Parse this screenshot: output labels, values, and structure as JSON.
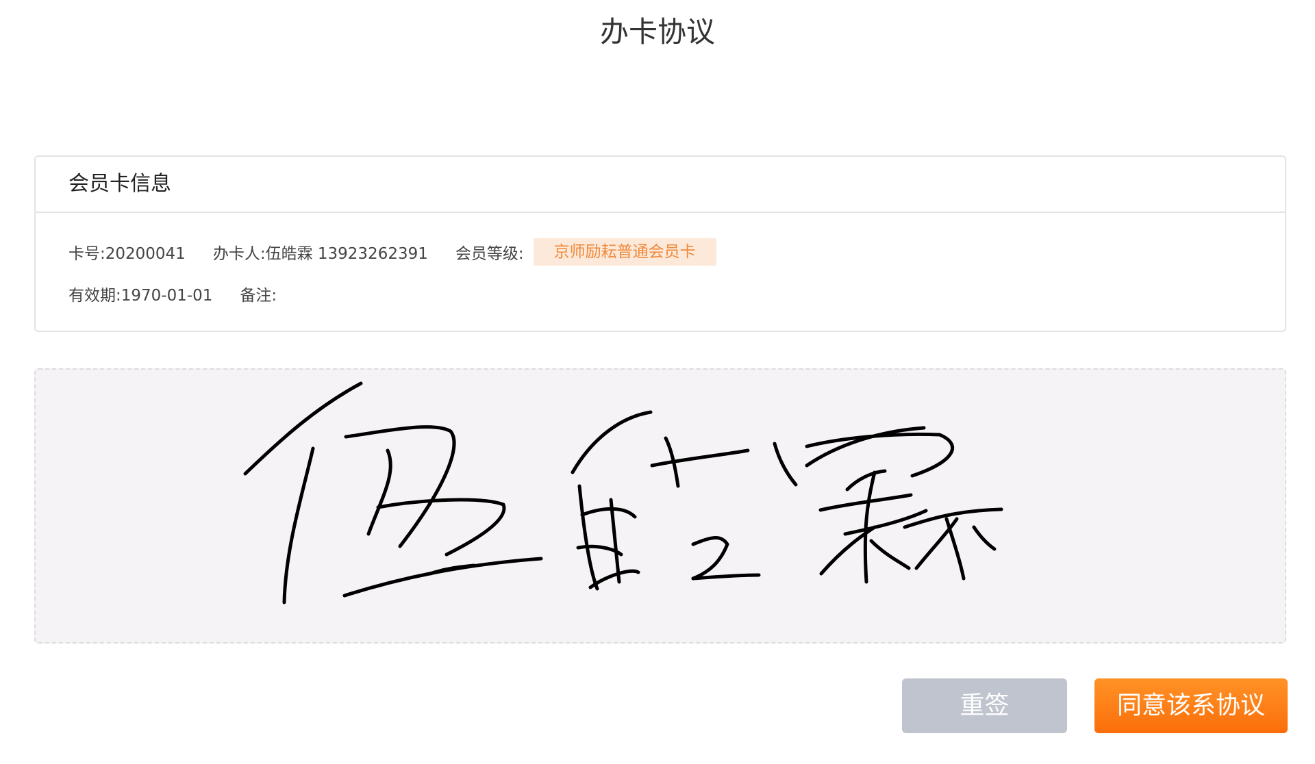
{
  "page": {
    "title": "办卡协议"
  },
  "card_info": {
    "header": "会员卡信息",
    "card_no": "卡号:20200041",
    "applicant": "办卡人:伍皓霖 13923262391",
    "level_label": "会员等级:",
    "level_value": "京师励耘普通会员卡",
    "validity": "有效期:1970-01-01",
    "remark": "备注:"
  },
  "signature": {
    "handwritten_text": "伍皓霖",
    "ink_color": "#000000",
    "pad_background": "#f6f3f6"
  },
  "actions": {
    "reset_label": "重签",
    "agree_label": "同意该系协议"
  },
  "colors": {
    "accent": "#fb7d16",
    "badge_bg": "#fde9d9",
    "badge_text": "#f0883a",
    "reset_bg": "#bfc4cf"
  }
}
